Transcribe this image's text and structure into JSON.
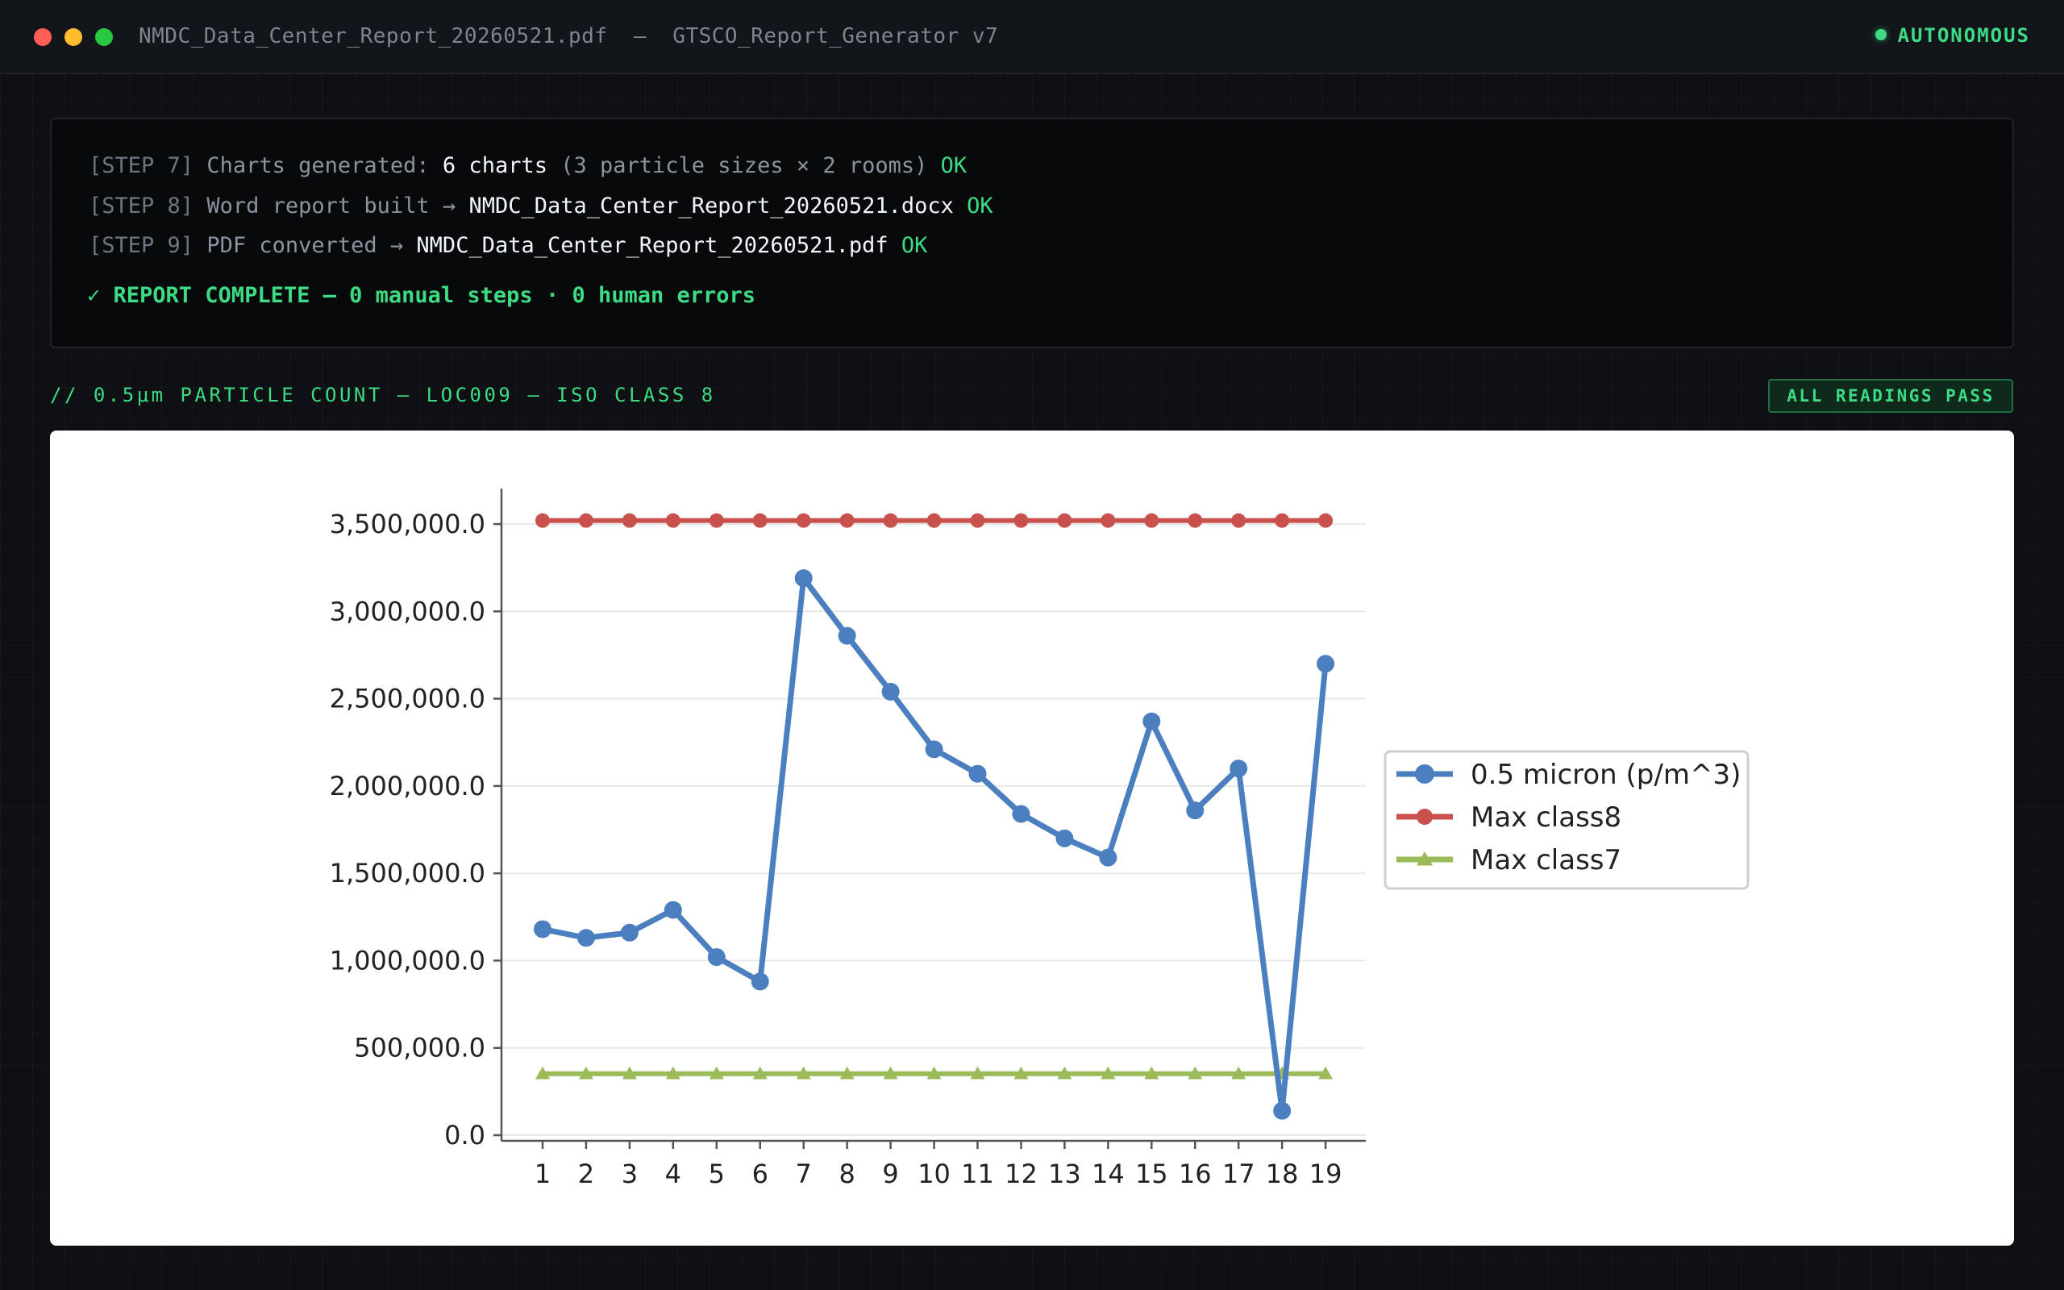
{
  "window": {
    "title": "NMDC_Data_Center_Report_20260521.pdf  —  GTSCO_Report_Generator v7",
    "status": "AUTONOMOUS"
  },
  "terminal": {
    "line1": {
      "step": "[STEP 7]",
      "a": "Charts generated:",
      "b": "6 charts",
      "c": "(3 particle sizes × 2 rooms)",
      "ok": "OK"
    },
    "line2": {
      "step": "[STEP 8]",
      "a": "Word report built →",
      "b": "NMDC_Data_Center_Report_20260521.docx",
      "ok": "OK"
    },
    "line3": {
      "step": "[STEP 9]",
      "a": "PDF converted →",
      "b": "NMDC_Data_Center_Report_20260521.pdf",
      "ok": "OK"
    },
    "complete": "✓ REPORT COMPLETE — 0 manual steps · 0 human errors"
  },
  "section": {
    "title": "// 0.5μm PARTICLE COUNT — LOC009 — ISO CLASS 8",
    "badge": "ALL READINGS PASS"
  },
  "chart_data": {
    "type": "line",
    "title": "",
    "xlabel": "",
    "ylabel": "",
    "x": [
      1,
      2,
      3,
      4,
      5,
      6,
      7,
      8,
      9,
      10,
      11,
      12,
      13,
      14,
      15,
      16,
      17,
      18,
      19
    ],
    "ylim": [
      0,
      3700000
    ],
    "yticks": [
      0,
      500000,
      1000000,
      1500000,
      2000000,
      2500000,
      3000000,
      3500000
    ],
    "ytick_labels": [
      "0.0",
      "500,000.0",
      "1,000,000.0",
      "1,500,000.0",
      "2,000,000.0",
      "2,500,000.0",
      "3,000,000.0",
      "3,500,000.0"
    ],
    "grid": "horizontal",
    "legend_position": "right",
    "series": [
      {
        "name": "0.5 micron (p/m^3)",
        "color": "#4c7fbf",
        "marker": "circle",
        "values": [
          1180000,
          1130000,
          1160000,
          1290000,
          1020000,
          880000,
          3190000,
          2860000,
          2540000,
          2210000,
          2070000,
          1840000,
          1700000,
          1590000,
          2370000,
          1860000,
          2100000,
          140000,
          2700000
        ]
      },
      {
        "name": "Max class8",
        "color": "#c8504d",
        "marker": "circle",
        "values": [
          3520000,
          3520000,
          3520000,
          3520000,
          3520000,
          3520000,
          3520000,
          3520000,
          3520000,
          3520000,
          3520000,
          3520000,
          3520000,
          3520000,
          3520000,
          3520000,
          3520000,
          3520000,
          3520000
        ]
      },
      {
        "name": "Max class7",
        "color": "#9bbb59",
        "marker": "triangle",
        "values": [
          352000,
          352000,
          352000,
          352000,
          352000,
          352000,
          352000,
          352000,
          352000,
          352000,
          352000,
          352000,
          352000,
          352000,
          352000,
          352000,
          352000,
          352000,
          352000
        ]
      }
    ]
  }
}
